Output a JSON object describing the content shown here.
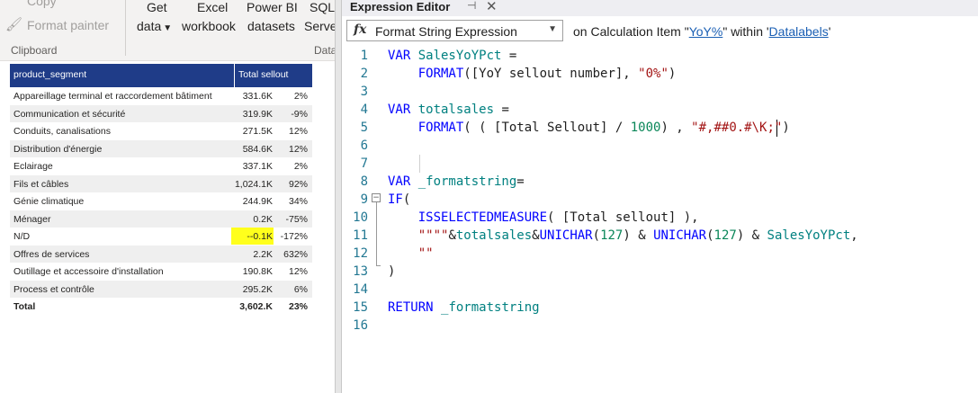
{
  "ribbon": {
    "copy_label": "Copy",
    "format_painter_label": "Format painter",
    "clipboard_group": "Clipboard",
    "get_data_line1": "Get",
    "get_data_line2": "data",
    "excel_line1": "Excel",
    "excel_line2": "workbook",
    "powerbi_line1": "Power BI",
    "powerbi_line2": "datasets",
    "sql_line1": "SQL",
    "sql_line2": "Server",
    "data_group": "Data"
  },
  "matrix": {
    "header_segment": "product_segment",
    "header_sellout": "Total sellout",
    "highlight_color": "#ffff1c",
    "header_color": "#1f3c88",
    "rows": [
      {
        "segment": "Appareillage terminal et raccordement bâtiment",
        "value": "331.6K",
        "pct": "2%"
      },
      {
        "segment": "Communication et sécurité",
        "value": "319.9K",
        "pct": "-9%"
      },
      {
        "segment": "Conduits, canalisations",
        "value": "271.5K",
        "pct": "12%"
      },
      {
        "segment": "Distribution d'énergie",
        "value": "584.6K",
        "pct": "12%"
      },
      {
        "segment": "Eclairage",
        "value": "337.1K",
        "pct": "2%"
      },
      {
        "segment": "Fils et câbles",
        "value": "1,024.1K",
        "pct": "92%"
      },
      {
        "segment": "Génie climatique",
        "value": "244.9K",
        "pct": "34%"
      },
      {
        "segment": "Ménager",
        "value": "0.2K",
        "pct": "-75%"
      },
      {
        "segment": "N/D",
        "value": "--0.1K",
        "pct": "-172%"
      },
      {
        "segment": "Offres de services",
        "value": "2.2K",
        "pct": "632%"
      },
      {
        "segment": "Outillage et accessoire d'installation",
        "value": "190.8K",
        "pct": "12%"
      },
      {
        "segment": "Process et contrôle",
        "value": "295.2K",
        "pct": "6%"
      },
      {
        "segment": "Total",
        "value": "3,602.K",
        "pct": "23%"
      }
    ]
  },
  "editor": {
    "title": "Expression Editor",
    "pin_icon": "pin-icon",
    "close_icon": "close-icon",
    "fx_label": "fx",
    "property": "Format String Expression",
    "context_prefix": "on Calculation Item \"",
    "calc_item": "YoY%",
    "context_middle": "\" within '",
    "calc_group": "Datalabels",
    "context_suffix": "'",
    "line_numbers": [
      "1",
      "2",
      "3",
      "4",
      "5",
      "6",
      "7",
      "8",
      "9",
      "10",
      "11",
      "12",
      "13",
      "14",
      "15",
      "16"
    ],
    "code_lines": [
      [
        {
          "t": "VAR ",
          "c": "kw"
        },
        {
          "t": "SalesYoYPct",
          "c": "var"
        },
        {
          "t": " =",
          "c": ""
        }
      ],
      [
        {
          "t": "    FORMAT",
          "c": "fn"
        },
        {
          "t": "([YoY sellout number], ",
          "c": ""
        },
        {
          "t": "\"0%\"",
          "c": "str"
        },
        {
          "t": ")",
          "c": ""
        }
      ],
      [],
      [
        {
          "t": "VAR ",
          "c": "kw"
        },
        {
          "t": "totalsales",
          "c": "var"
        },
        {
          "t": " =",
          "c": ""
        }
      ],
      [
        {
          "t": "    FORMAT",
          "c": "fn"
        },
        {
          "t": "( ( [Total Sellout] / ",
          "c": ""
        },
        {
          "t": "1000",
          "c": "num"
        },
        {
          "t": ") , ",
          "c": ""
        },
        {
          "t": "\"#,##0.#\\K;\"",
          "c": "str"
        },
        {
          "t": ")",
          "c": ""
        }
      ],
      [],
      [],
      [
        {
          "t": "VAR ",
          "c": "kw"
        },
        {
          "t": "_formatstring",
          "c": "var"
        },
        {
          "t": "=",
          "c": ""
        }
      ],
      [
        {
          "t": "IF",
          "c": "fn"
        },
        {
          "t": "(",
          "c": ""
        }
      ],
      [
        {
          "t": "    ISSELECTEDMEASURE",
          "c": "fn"
        },
        {
          "t": "( [Total sellout] ),",
          "c": ""
        }
      ],
      [
        {
          "t": "    \"\"\"\"",
          "c": "str"
        },
        {
          "t": "&",
          "c": ""
        },
        {
          "t": "totalsales",
          "c": "var"
        },
        {
          "t": "&",
          "c": ""
        },
        {
          "t": "UNICHAR",
          "c": "fn"
        },
        {
          "t": "(",
          "c": ""
        },
        {
          "t": "127",
          "c": "num"
        },
        {
          "t": ") & ",
          "c": ""
        },
        {
          "t": "UNICHAR",
          "c": "fn"
        },
        {
          "t": "(",
          "c": ""
        },
        {
          "t": "127",
          "c": "num"
        },
        {
          "t": ") & ",
          "c": ""
        },
        {
          "t": "SalesYoYPct",
          "c": "var"
        },
        {
          "t": ",",
          "c": ""
        }
      ],
      [
        {
          "t": "    \"\"",
          "c": "str"
        }
      ],
      [
        {
          "t": ")",
          "c": ""
        }
      ],
      [],
      [
        {
          "t": "RETURN ",
          "c": "kw"
        },
        {
          "t": "_formatstring",
          "c": "var"
        }
      ],
      []
    ]
  }
}
